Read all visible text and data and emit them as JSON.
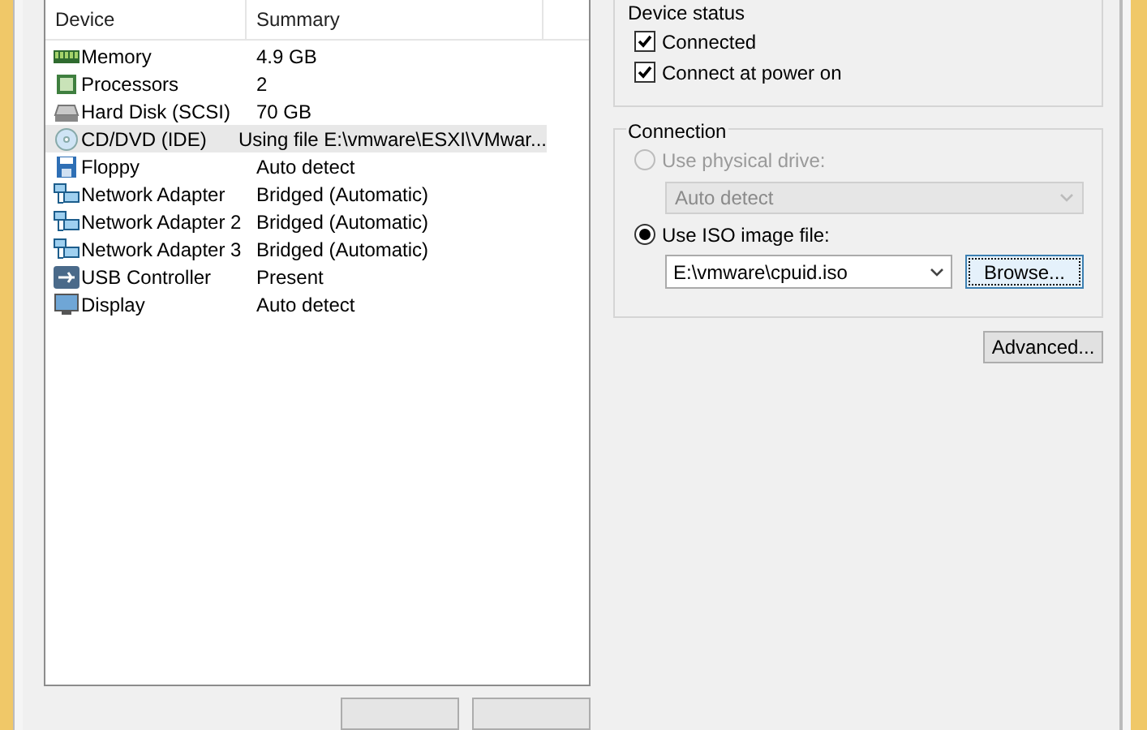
{
  "device_table": {
    "columns": [
      "Device",
      "Summary"
    ],
    "rows": [
      {
        "kind": "memory",
        "device": "Memory",
        "summary": "4.9 GB",
        "selected": false
      },
      {
        "kind": "processor",
        "device": "Processors",
        "summary": "2",
        "selected": false
      },
      {
        "kind": "disk",
        "device": "Hard Disk (SCSI)",
        "summary": "70 GB",
        "selected": false
      },
      {
        "kind": "cd",
        "device": "CD/DVD (IDE)",
        "summary": "Using file E:\\vmware\\ESXI\\VMwar...",
        "selected": true
      },
      {
        "kind": "floppy",
        "device": "Floppy",
        "summary": "Auto detect",
        "selected": false
      },
      {
        "kind": "network",
        "device": "Network Adapter",
        "summary": "Bridged (Automatic)",
        "selected": false
      },
      {
        "kind": "network",
        "device": "Network Adapter 2",
        "summary": "Bridged (Automatic)",
        "selected": false
      },
      {
        "kind": "network",
        "device": "Network Adapter 3",
        "summary": "Bridged (Automatic)",
        "selected": false
      },
      {
        "kind": "usb",
        "device": "USB Controller",
        "summary": "Present",
        "selected": false
      },
      {
        "kind": "display",
        "device": "Display",
        "summary": "Auto detect",
        "selected": false
      }
    ]
  },
  "device_status": {
    "title": "Device status",
    "options": [
      {
        "label": "Connected",
        "checked": true
      },
      {
        "label": "Connect at power on",
        "checked": true
      }
    ]
  },
  "connection": {
    "title": "Connection",
    "physical": {
      "label": "Use physical drive:",
      "selected": false,
      "disabled": true,
      "dropdown": "Auto detect"
    },
    "iso": {
      "label": "Use ISO image file:",
      "selected": true,
      "disabled": false,
      "value": "E:\\vmware\\cpuid.iso",
      "browse": "Browse..."
    }
  },
  "advanced_button": "Advanced..."
}
